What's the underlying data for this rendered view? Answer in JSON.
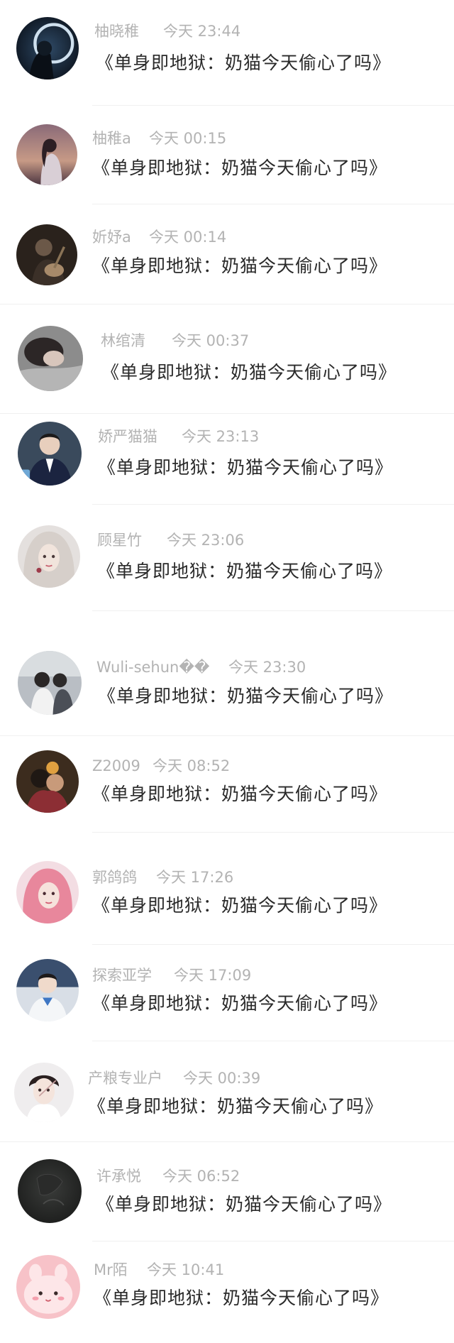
{
  "feed": {
    "items": [
      {
        "username": "柚晓稚",
        "time": "今天 23:44",
        "message": "《单身即地狱：奶猫今天偷心了吗》",
        "avatar": "moon-night-avatar"
      },
      {
        "username": "柚稚a",
        "time": "今天 00:15",
        "message": "《单身即地狱：奶猫今天偷心了吗》",
        "avatar": "girl-sunset-avatar"
      },
      {
        "username": "妡妤a",
        "time": "今天 00:14",
        "message": "《单身即地狱：奶猫今天偷心了吗》",
        "avatar": "guitar-person-avatar"
      },
      {
        "username": "林绾清",
        "time": "今天 00:37",
        "message": "《单身即地狱：奶猫今天偷心了吗》",
        "avatar": "girl-lying-avatar"
      },
      {
        "username": "娇严猫猫",
        "time": "今天 23:13",
        "message": "《单身即地狱：奶猫今天偷心了吗》",
        "avatar": "boy-suit-avatar"
      },
      {
        "username": "顾星竹",
        "time": "今天 23:06",
        "message": "《单身即地狱：奶猫今天偷心了吗》",
        "avatar": "platinum-hair-girl-avatar"
      },
      {
        "username": "Wuli-sehun��",
        "time": "今天 23:30",
        "message": "《单身即地狱：奶猫今天偷心了吗》",
        "avatar": "car-couple-avatar"
      },
      {
        "username": "Z2009",
        "time": "今天 08:52",
        "message": "《单身即地狱：奶猫今天偷心了吗》",
        "avatar": "couple-embrace-avatar"
      },
      {
        "username": "郭鸽鸽",
        "time": "今天 17:26",
        "message": "《单身即地狱：奶猫今天偷心了吗》",
        "avatar": "pink-hair-girl-avatar"
      },
      {
        "username": "探索亚学",
        "time": "今天 17:09",
        "message": "《单身即地狱：奶猫今天偷心了吗》",
        "avatar": "boy-blue-collar-avatar"
      },
      {
        "username": "产粮专业户",
        "time": "今天 00:39",
        "message": "《单身即地狱：奶猫今天偷心了吗》",
        "avatar": "young-man-portrait-avatar"
      },
      {
        "username": "许承悦",
        "time": "今天 06:52",
        "message": "《单身即地狱：奶猫今天偷心了吗》",
        "avatar": "dark-sketch-avatar"
      },
      {
        "username": "Mr陌",
        "time": "今天 10:41",
        "message": "《单身即地狱：奶猫今天偷心了吗》",
        "avatar": "pink-cartoon-avatar"
      }
    ]
  }
}
